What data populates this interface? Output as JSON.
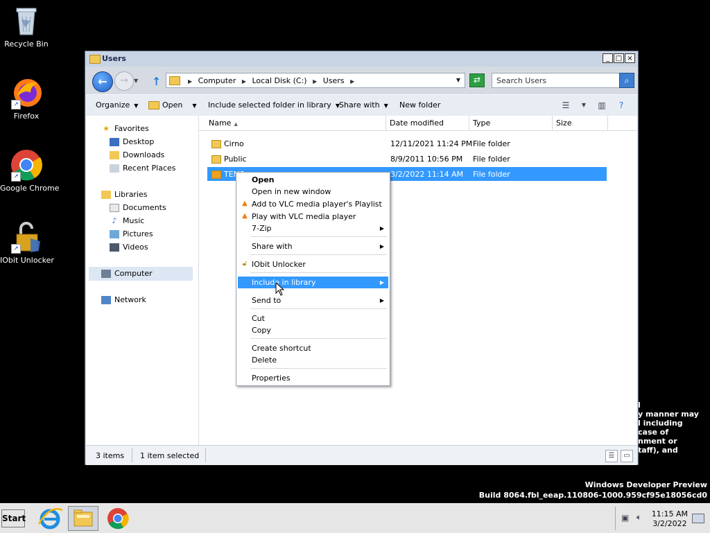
{
  "desktop": {
    "icons": [
      {
        "label": "Recycle Bin"
      },
      {
        "label": "Firefox"
      },
      {
        "label": "Google Chrome"
      },
      {
        "label": "IObit Unlocker"
      }
    ],
    "watermark": {
      "line1": "Windows Developer Preview",
      "line2": "Build 8064.fbl_eeap.110806-1000.959cf95e18056cd0"
    },
    "partial_text": [
      "l",
      "y manner may",
      "l including",
      "case of",
      "nment or",
      "taff), and"
    ]
  },
  "window": {
    "title": "Users",
    "controls": {
      "minimize": "_",
      "maximize": "□",
      "close": "×"
    },
    "address": {
      "crumbs": [
        "Computer",
        "Local Disk (C:)",
        "Users"
      ]
    },
    "search": {
      "placeholder": "Search Users"
    },
    "toolbar": {
      "organize": "Organize",
      "open": "Open",
      "include": "Include selected folder in library",
      "share": "Share with",
      "new_folder": "New folder"
    },
    "navpane": {
      "favorites": "Favorites",
      "desktop": "Desktop",
      "downloads": "Downloads",
      "recent": "Recent Places",
      "libraries": "Libraries",
      "documents": "Documents",
      "music": "Music",
      "pictures": "Pictures",
      "videos": "Videos",
      "computer": "Computer",
      "network": "Network"
    },
    "columns": {
      "name": "Name",
      "date": "Date modified",
      "type": "Type",
      "size": "Size"
    },
    "files": [
      {
        "name": "Cirno",
        "date": "12/11/2021 11:24 PM",
        "type": "File folder"
      },
      {
        "name": "Public",
        "date": "8/9/2011 10:56 PM",
        "type": "File folder"
      },
      {
        "name": "TEMP",
        "date": "3/2/2022 11:14 AM",
        "type": "File folder"
      }
    ],
    "status": {
      "items": "3 items",
      "selected": "1 item selected"
    }
  },
  "context_menu": {
    "open": "Open",
    "open_new": "Open in new window",
    "vlc_add": "Add to VLC media player's Playlist",
    "vlc_play": "Play with VLC media player",
    "zip": "7-Zip",
    "share": "Share with",
    "iobit": "IObit Unlocker",
    "include": "Include in library",
    "send_to": "Send to",
    "cut": "Cut",
    "copy": "Copy",
    "shortcut": "Create shortcut",
    "delete": "Delete",
    "properties": "Properties"
  },
  "taskbar": {
    "start": "Start",
    "time": "11:15 AM",
    "date": "3/2/2022"
  },
  "colors": {
    "selection": "#3399ff",
    "folder": "#f2c855",
    "accent": "#1e5fc6"
  }
}
